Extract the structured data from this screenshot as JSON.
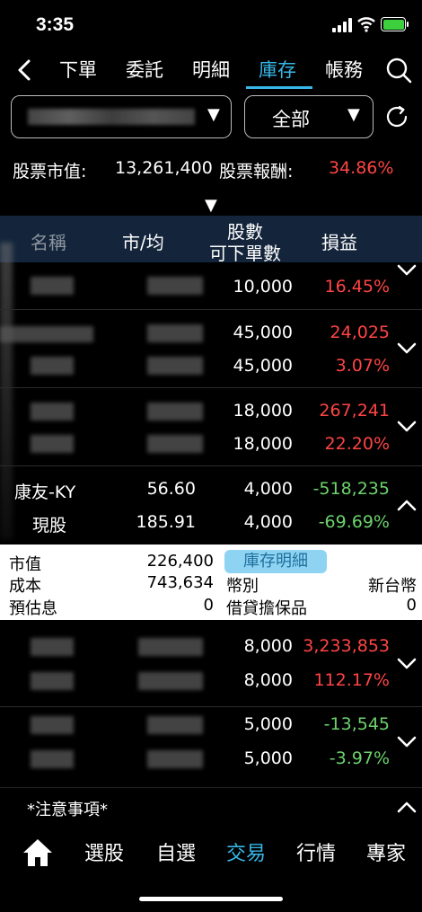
{
  "status_bar": {
    "time": "3:35"
  },
  "nav": {
    "tabs": [
      "下單",
      "委託",
      "明細",
      "庫存",
      "帳務"
    ],
    "active_tab": "庫存"
  },
  "filters": {
    "type_label": "全部",
    "caret": "▼"
  },
  "summary": {
    "market_value_label": "股票市值:",
    "market_value": "13,261,400",
    "return_label": "股票報酬:",
    "return_value": "34.86%"
  },
  "table": {
    "headers": {
      "name": "名稱",
      "price": "市/均",
      "qty1": "股數",
      "qty2": "可下單數",
      "pnl": "損益"
    },
    "rows": [
      {
        "qty1": "10,000",
        "pnl1": "16.45%"
      },
      {
        "qty1": "45,000",
        "qty2": "45,000",
        "pnl1": "24,025",
        "pnl2": "3.07%"
      },
      {
        "qty1": "18,000",
        "qty2": "18,000",
        "pnl1": "267,241",
        "pnl2": "22.20%"
      },
      {
        "name": "康友-KY",
        "sub": "現股",
        "p1": "56.60",
        "p2": "185.91",
        "qty1": "4,000",
        "qty2": "4,000",
        "pnl1": "-518,235",
        "pnl2": "-69.69%"
      },
      {
        "qty1": "8,000",
        "qty2": "8,000",
        "pnl1": "3,233,853",
        "pnl2": "112.17%"
      },
      {
        "qty1": "5,000",
        "qty2": "5,000",
        "pnl1": "-13,545",
        "pnl2": "-3.97%"
      }
    ]
  },
  "detail": {
    "market_value_label": "市值",
    "market_value": "226,400",
    "cost_label": "成本",
    "cost": "743,634",
    "dividend_label": "預估息",
    "dividend": "0",
    "badge": "庫存明細",
    "currency_label": "幣別",
    "currency": "新台幣",
    "collateral_label": "借貸擔保品",
    "collateral": "0"
  },
  "notice": {
    "label": "*注意事項*"
  },
  "bottom_nav": {
    "items": [
      "選股",
      "自選",
      "交易",
      "行情",
      "專家"
    ],
    "active": "交易"
  },
  "colors": {
    "accent": "#37b8e8",
    "positive": "#ff4444",
    "negative": "#6cd36c",
    "header_bg": "#14253b"
  }
}
